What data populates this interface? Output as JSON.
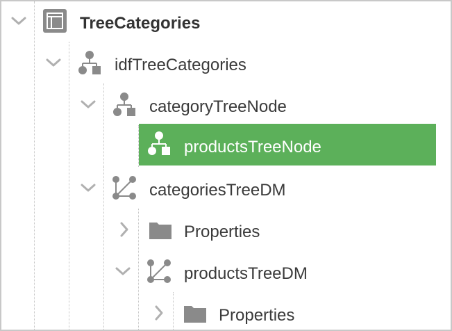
{
  "colors": {
    "selection": "#5cb05a",
    "icon": "#8a8a8a",
    "text": "#3a3a3a"
  },
  "tree": {
    "root": {
      "label": "TreeCategories",
      "icon": "panel-icon",
      "expanded": true
    },
    "idf": {
      "label": "idfTreeCategories",
      "icon": "hierarchy-icon",
      "expanded": true
    },
    "category_node": {
      "label": "categoryTreeNode",
      "icon": "hierarchy-icon",
      "expanded": true
    },
    "products_node": {
      "label": "productsTreeNode",
      "icon": "hierarchy-icon",
      "selected": true
    },
    "categories_dm": {
      "label": "categoriesTreeDM",
      "icon": "datamodel-icon",
      "expanded": true
    },
    "categories_props": {
      "label": "Properties",
      "icon": "folder-icon",
      "expanded": false
    },
    "products_dm": {
      "label": "productsTreeDM",
      "icon": "datamodel-icon",
      "expanded": true
    },
    "products_props": {
      "label": "Properties",
      "icon": "folder-icon",
      "expanded": false
    }
  }
}
